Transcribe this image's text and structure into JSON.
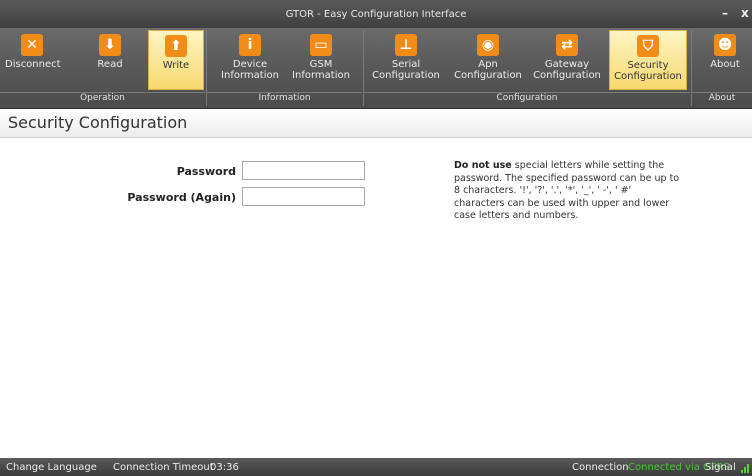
{
  "window": {
    "title": "GTOR - Easy Configuration Interface",
    "minimize": "–",
    "close": "x"
  },
  "ribbon": {
    "groups": {
      "operation": "Operation",
      "information": "Information",
      "configuration": "Configuration",
      "about": "About"
    },
    "buttons": {
      "disconnect": {
        "label": "Disconnect",
        "icon": "close-icon"
      },
      "read": {
        "label": "Read",
        "icon": "cloud-download-icon"
      },
      "write": {
        "label": "Write",
        "icon": "cloud-upload-icon"
      },
      "device_information": {
        "label1": "Device",
        "label2": "Information",
        "icon": "info-icon"
      },
      "gsm_information": {
        "label1": "GSM",
        "label2": "Information",
        "icon": "sim-card-icon"
      },
      "serial_configuration": {
        "label1": "Serial",
        "label2": "Configuration",
        "icon": "network-icon"
      },
      "apn_configuration": {
        "label1": "Apn",
        "label2": "Configuration",
        "icon": "globe-icon"
      },
      "gateway_configuration": {
        "label1": "Gateway",
        "label2": "Configuration",
        "icon": "gateway-icon"
      },
      "security_configuration": {
        "label1": "Security",
        "label2": "Configuration",
        "icon": "shield-icon"
      },
      "about": {
        "label": "About",
        "icon": "people-icon"
      }
    },
    "accent_color": "#f28c18",
    "active_color": "#f7d96e"
  },
  "page": {
    "title": "Security Configuration",
    "password_label": "Password",
    "password_value": "",
    "password_again_label": "Password (Again)",
    "password_again_value": "",
    "note_bold": "Do not use",
    "note_text": " special letters while setting the password. The specified password can be up to 8 characters. '!', '?', '.', '*', '_', ' -', ' #' characters can be used with upper and lower case letters and numbers."
  },
  "statusbar": {
    "change_language": "Change Language",
    "timeout_label": "Connection Timeout",
    "timeout_value": "03:36",
    "connection_label": "Connection",
    "connection_value": "Connected via GPRS",
    "connection_color": "#4fc23a",
    "signal_label": "Signal"
  }
}
